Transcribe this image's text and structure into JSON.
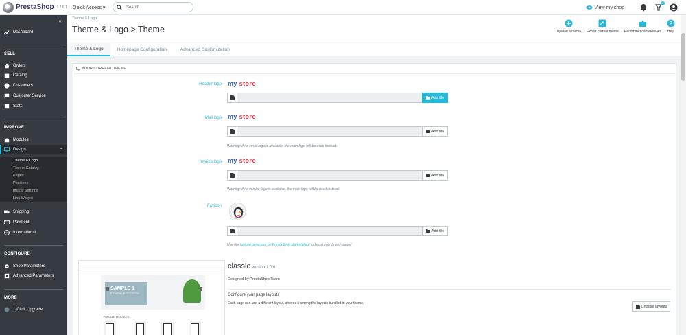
{
  "app": {
    "brand": "PrestaShop",
    "version": "1.7.6.1",
    "quick_access": "Quick Access ▾",
    "search_placeholder": "Search",
    "view_shop": "View my shop",
    "notifications_count": "8"
  },
  "sidebar": {
    "dashboard": "Dashboard",
    "sell_title": "SELL",
    "sell": [
      "Orders",
      "Catalog",
      "Customers",
      "Customer Service",
      "Stats"
    ],
    "improve_title": "IMPROVE",
    "modules": "Modules",
    "design": "Design",
    "design_sub": [
      "Theme & Logo",
      "Theme Catalog",
      "Pages",
      "Positions",
      "Image Settings",
      "Link Widget"
    ],
    "after_design": [
      "Shipping",
      "Payment",
      "International"
    ],
    "configure_title": "CONFIGURE",
    "configure": [
      "Shop Parameters",
      "Advanced Parameters"
    ],
    "more_title": "MORE",
    "upgrade": "1-Click Upgrade"
  },
  "header": {
    "breadcrumb": "Theme & Logo",
    "title": "Theme & Logo > Theme",
    "actions": [
      "Upload a theme",
      "Export current theme",
      "Recommended Modules",
      "Help"
    ]
  },
  "tabs": [
    "Theme & Logo",
    "Homepage Configuration",
    "Advanced Customization"
  ],
  "panel": {
    "heading": "YOUR CURRENT THEME",
    "header_logo_label": "Header logo",
    "mail_logo_label": "Mail logo",
    "invoice_logo_label": "Invoice logo",
    "favicon_label": "Favicon",
    "logo_text_1": "my",
    "logo_text_2": "store",
    "add_file": "Add file",
    "mail_warning": "Warning: if no email logo is available, the main logo will be used instead.",
    "invoice_warning": "Warning: if no invoice logo is available, the main logo will be used instead.",
    "favicon_note_1": "Use our",
    "favicon_link_1": "favicon generator on",
    "favicon_link_2": "PrestaShop Marketplace",
    "favicon_note_2": "to boost your brand image!"
  },
  "theme": {
    "name": "classic",
    "version": "version 1.0.0",
    "designed_by": "Designed by PrestaShop Team",
    "layouts_title": "Configure your page layouts",
    "layouts_desc": "Each page can use a different layout, choose it among the layouts bundled in your theme.",
    "choose_layouts": "Choose layouts",
    "preview_slide_title": "SAMPLE 1",
    "preview_slide_sub": "EXCEPTEUR OCCAECAT",
    "preview_products": "POPULAR PRODUCTS"
  },
  "colors": {
    "accent": "#25b9d7",
    "sidebar": "#363a41"
  }
}
